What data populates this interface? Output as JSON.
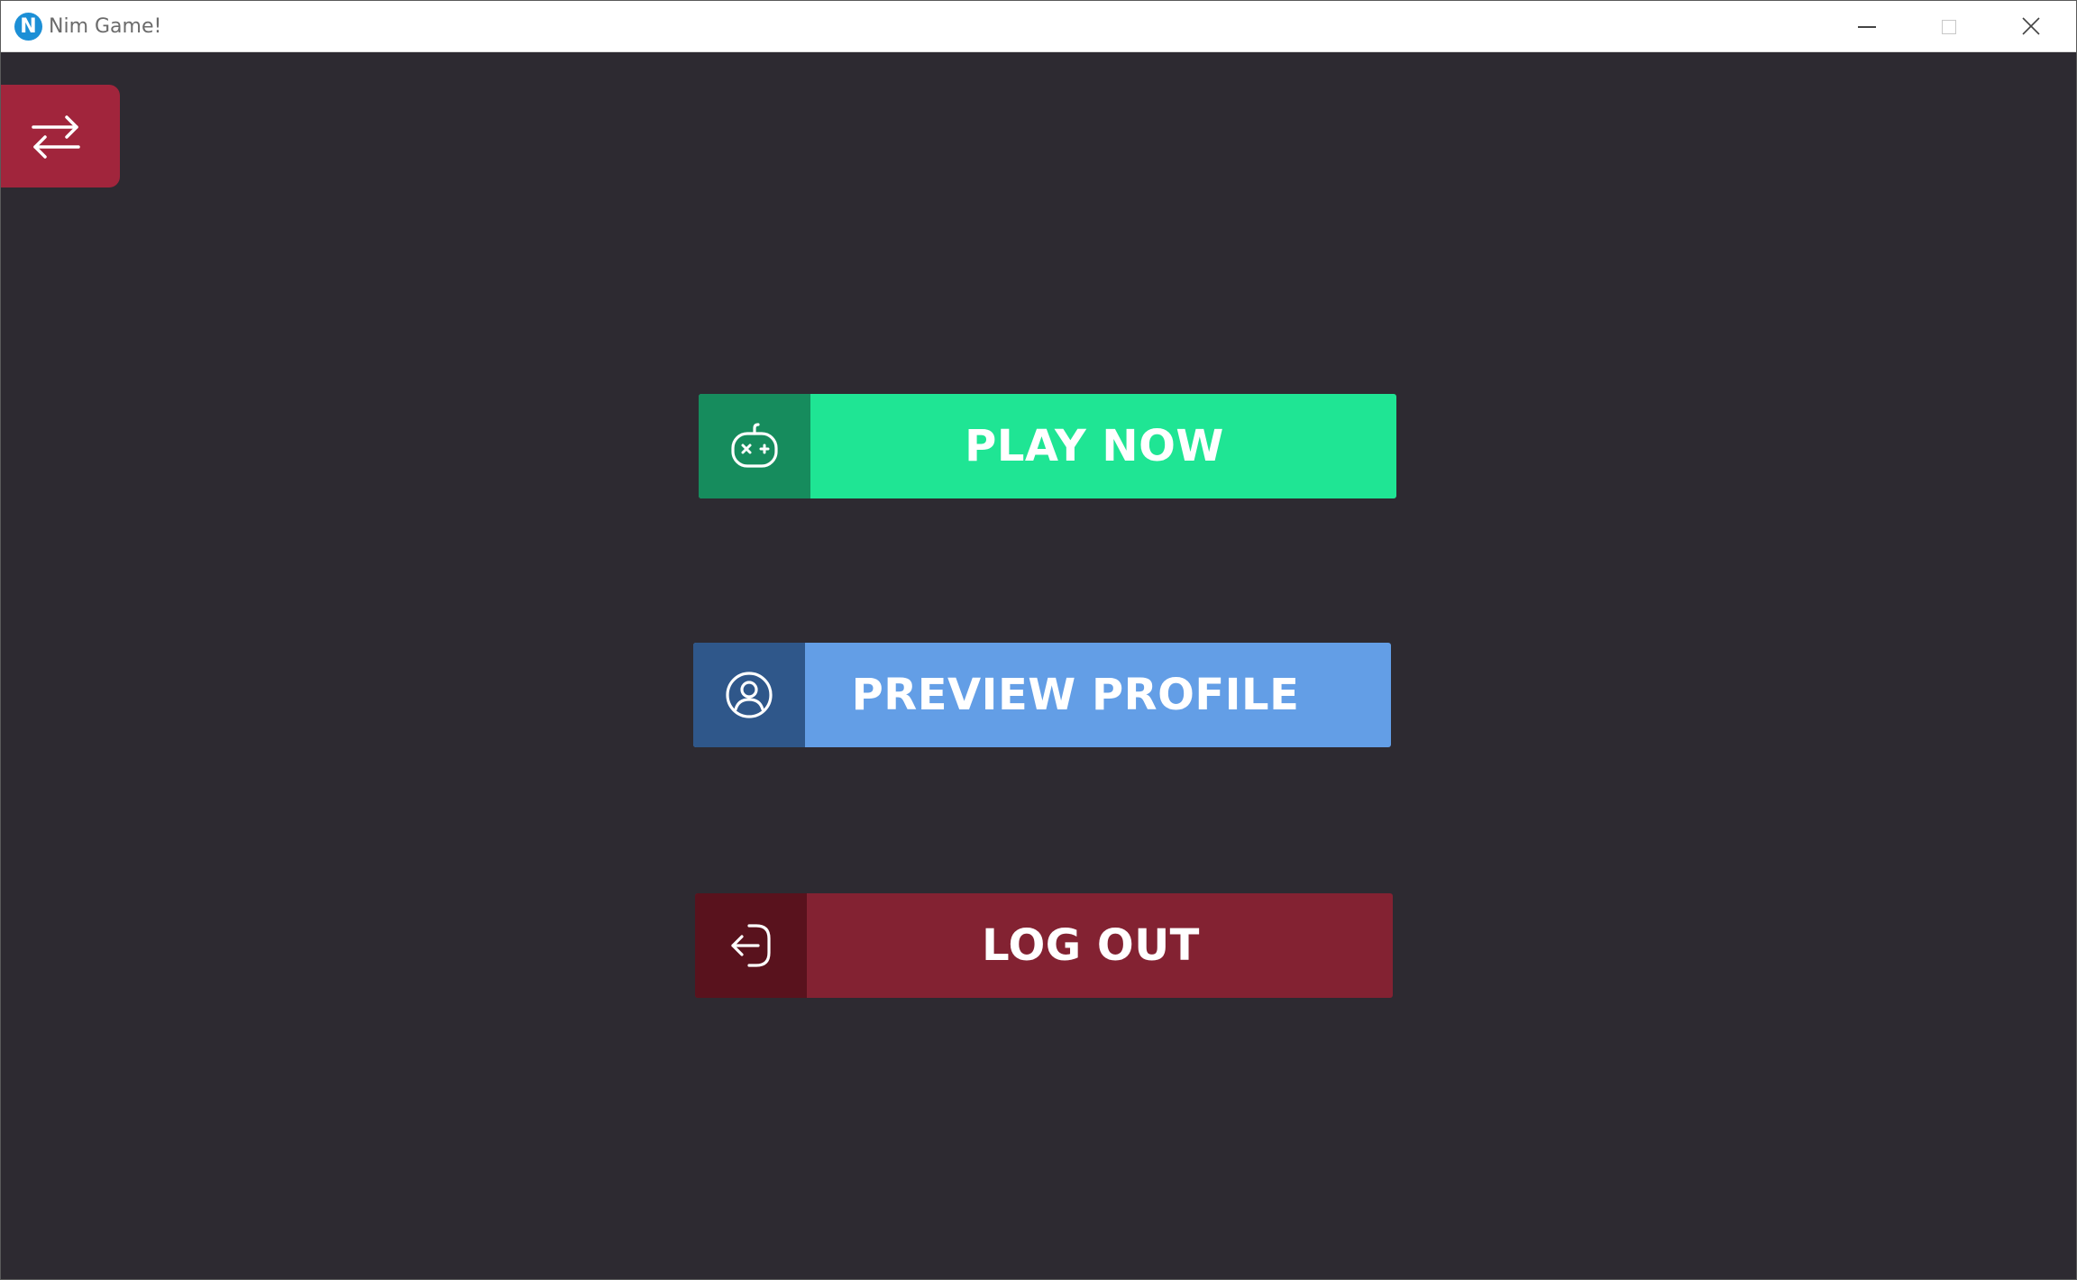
{
  "window": {
    "title": "Nim Game!",
    "app_icon_letter": "N",
    "controls": [
      "minimize-icon",
      "maximize-icon",
      "close-icon"
    ]
  },
  "top_left_button": {
    "icon": "swap-arrows-icon",
    "color": "#a1253c"
  },
  "menu": {
    "play": {
      "label": "PLAY NOW",
      "icon": "gamepad-icon",
      "color": "#1fe594",
      "icon_bg": "#168c5d"
    },
    "profile": {
      "label": "PREVIEW PROFILE",
      "icon": "user-circle-icon",
      "color": "#639ee6",
      "icon_bg": "#2f578a"
    },
    "logout": {
      "label": "LOG OUT",
      "icon": "logout-icon",
      "color": "#832232",
      "icon_bg": "#59121d"
    }
  },
  "colors": {
    "background": "#2d2a31"
  }
}
